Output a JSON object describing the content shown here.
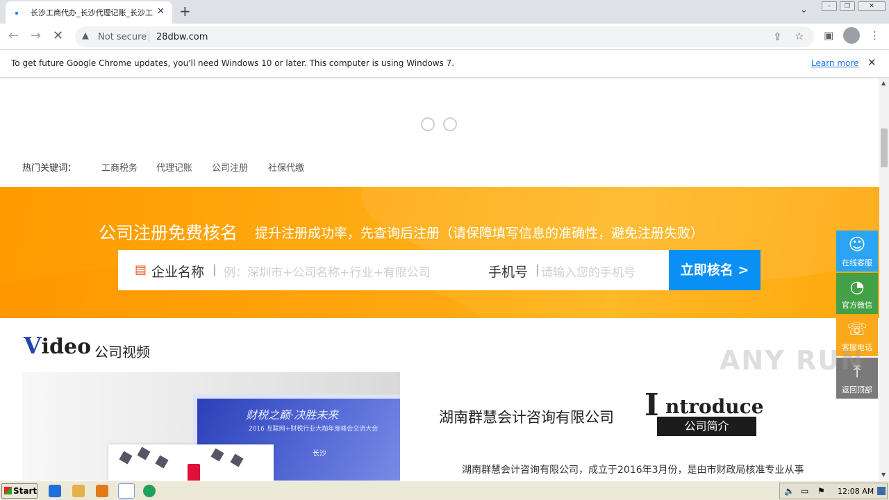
{
  "browser": {
    "tab_title": "长沙工商代办_长沙代理记账_长沙工",
    "new_tab": "+",
    "tab_close": "✕",
    "security_label": "Not secure",
    "url": "28dbw.com",
    "window_controls": [
      "minimize-icon",
      "restore-icon",
      "close-icon"
    ]
  },
  "infobar": {
    "message": "To get future Google Chrome updates, you'll need Windows 10 or later. This computer is using Windows 7.",
    "learn_more": "Learn more",
    "close": "✕"
  },
  "page": {
    "keywords_label": "热门关键词：",
    "keywords": [
      "工商税务",
      "代理记账",
      "公司注册",
      "社保代缴"
    ],
    "banner": {
      "title": "公司注册免费核名",
      "subtitle": "提升注册成功率，先查询后注册（请保障填写信息的准确性，避免注册失败）",
      "company_label": "企业名称",
      "company_placeholder": "例：深圳市+公司名称+行业+有限公司",
      "phone_label": "手机号",
      "phone_placeholder": "请输入您的手机号",
      "submit": "立即核名 >"
    },
    "video": {
      "title_initial": "V",
      "title_rest": "ideo",
      "subtitle": "公司视频",
      "thumb_text_1": "财税之巅·决胜未来",
      "thumb_text_2": "2016 互联网+财税行业大咖年度峰会交流大会",
      "thumb_text_3": "长沙"
    },
    "intro": {
      "company": "湖南群慧会计咨询有限公司",
      "title_initial": "I",
      "title_rest": "ntroduce",
      "tag": "公司简介",
      "text": "湖南群慧会计咨询有限公司，成立于2016年3月份，是由市财政局核准专业从事"
    },
    "sidebar": [
      {
        "label": "在线客服",
        "icon": "qq-icon",
        "color": "#2aa4f4"
      },
      {
        "label": "官方微信",
        "icon": "wechat-icon",
        "color": "#43a047"
      },
      {
        "label": "客服电话",
        "icon": "phone-icon",
        "color": "#fba81a"
      },
      {
        "label": "返回顶部",
        "icon": "arrow-up-icon",
        "color": "#7a7a7a"
      }
    ]
  },
  "watermark": "ANY RUN",
  "taskbar": {
    "start": "Start",
    "clock": "12:08 AM"
  }
}
